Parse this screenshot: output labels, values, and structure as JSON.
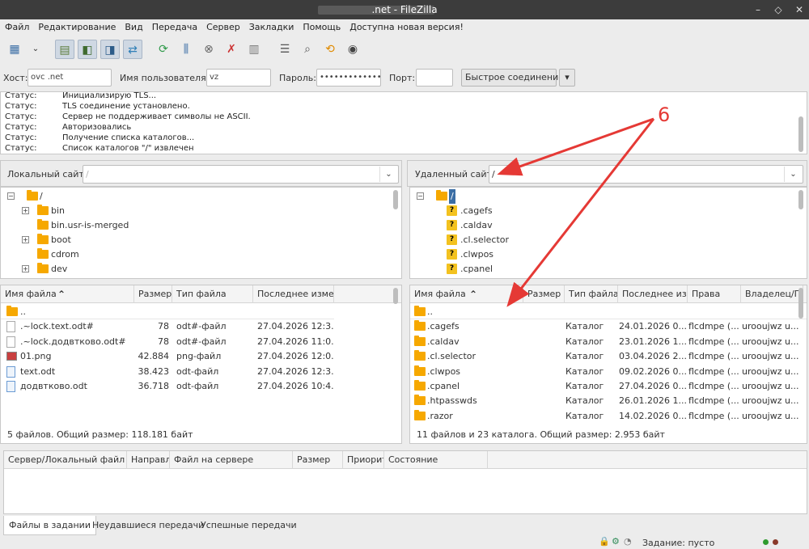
{
  "window": {
    "title": ".net - FileZilla"
  },
  "menu": [
    "Файл",
    "Редактирование",
    "Вид",
    "Передача",
    "Сервер",
    "Закладки",
    "Помощь",
    "Доступна новая версия!"
  ],
  "quickconnect": {
    "host_label": "Хост:",
    "host_value": "ovc                .net",
    "user_label": "Имя пользователя:",
    "user_value": "                  vz",
    "pass_label": "Пароль:",
    "pass_value": "••••••••••••••",
    "port_label": "Порт:",
    "port_value": "",
    "connect": "Быстрое соединение"
  },
  "log": [
    {
      "s": "Статус:",
      "m": "Инициализирую TLS..."
    },
    {
      "s": "Статус:",
      "m": "TLS соединение установлено."
    },
    {
      "s": "Статус:",
      "m": "Сервер не поддерживает символы не ASCII."
    },
    {
      "s": "Статус:",
      "m": "Авторизовались"
    },
    {
      "s": "Статус:",
      "m": "Получение списка каталогов..."
    },
    {
      "s": "Статус:",
      "m": "Список каталогов \"/\" извлечен"
    }
  ],
  "local": {
    "site_label": "Локальный сайт:",
    "site_value": "/",
    "tree": [
      {
        "name": "/",
        "root": true
      },
      {
        "name": "bin",
        "plus": true
      },
      {
        "name": "bin.usr-is-merged",
        "plus": false
      },
      {
        "name": "boot",
        "plus": true
      },
      {
        "name": "cdrom",
        "plus": false
      },
      {
        "name": "dev",
        "plus": true
      }
    ],
    "headers": [
      "Имя файла",
      "Размер",
      "Тип файла",
      "Последнее измене"
    ],
    "files": [
      {
        "icon": "folder",
        "name": "..",
        "size": "",
        "type": "",
        "date": ""
      },
      {
        "icon": "doc",
        "name": ".~lock.text.odt#",
        "size": "78",
        "type": "odt#-файл",
        "date": "27.04.2026 12:3..."
      },
      {
        "icon": "doc",
        "name": ".~lock.додвтково.odt#",
        "size": "78",
        "type": "odt#-файл",
        "date": "27.04.2026 11:0..."
      },
      {
        "icon": "img",
        "name": "01.png",
        "size": "42.884",
        "type": "png-файл",
        "date": "27.04.2026 12:0..."
      },
      {
        "icon": "odt",
        "name": "text.odt",
        "size": "38.423",
        "type": "odt-файл",
        "date": "27.04.2026 12:3..."
      },
      {
        "icon": "odt",
        "name": "додвтково.odt",
        "size": "36.718",
        "type": "odt-файл",
        "date": "27.04.2026 10:4..."
      }
    ],
    "status": "5 файлов. Общий размер: 118.181 байт"
  },
  "remote": {
    "site_label": "Удаленный сайт:",
    "site_value": "/",
    "tree": [
      {
        "name": "/",
        "root": true
      },
      {
        "name": ".cagefs"
      },
      {
        "name": ".caldav"
      },
      {
        "name": ".cl.selector"
      },
      {
        "name": ".clwpos"
      },
      {
        "name": ".cpanel"
      }
    ],
    "headers": [
      "Имя файла",
      "Размер",
      "Тип файла",
      "Последнее изм",
      "Права",
      "Владелец/Гр"
    ],
    "files": [
      {
        "name": "..",
        "type": "",
        "date": "",
        "perm": "",
        "owner": ""
      },
      {
        "name": ".cagefs",
        "type": "Каталог",
        "date": "24.01.2026 0...",
        "perm": "flcdmpe (...",
        "owner": "urooujwz u..."
      },
      {
        "name": ".caldav",
        "type": "Каталог",
        "date": "23.01.2026 1...",
        "perm": "flcdmpe (...",
        "owner": "urooujwz u..."
      },
      {
        "name": ".cl.selector",
        "type": "Каталог",
        "date": "03.04.2026 2...",
        "perm": "flcdmpe (...",
        "owner": "urooujwz u..."
      },
      {
        "name": ".clwpos",
        "type": "Каталог",
        "date": "09.02.2026 0...",
        "perm": "flcdmpe (...",
        "owner": "urooujwz u..."
      },
      {
        "name": ".cpanel",
        "type": "Каталог",
        "date": "27.04.2026 0...",
        "perm": "flcdmpe (...",
        "owner": "urooujwz u..."
      },
      {
        "name": ".htpasswds",
        "type": "Каталог",
        "date": "26.01.2026 1...",
        "perm": "flcdmpe (...",
        "owner": "urooujwz u..."
      },
      {
        "name": ".razor",
        "type": "Каталог",
        "date": "14.02.2026 0...",
        "perm": "flcdmpe (...",
        "owner": "urooujwz u..."
      }
    ],
    "status": "11 файлов и 23 каталога. Общий размер: 2.953 байт"
  },
  "queue": {
    "headers": [
      "Сервер/Локальный файл",
      "Направл",
      "Файл на сервере",
      "Размер",
      "Приорит",
      "Состояние"
    ]
  },
  "tabs": [
    "Файлы в задании",
    "Неудавшиеся передачи",
    "Успешные передачи"
  ],
  "statusbar": {
    "queue": "Задание: пусто"
  },
  "annotation": {
    "label": "6",
    "color": "#e53935"
  }
}
